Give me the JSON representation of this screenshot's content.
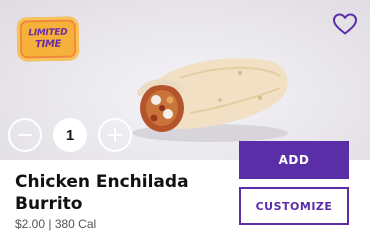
{
  "badge": {
    "line1": "LIMITED",
    "line2": "TIME"
  },
  "product": {
    "name": "Chicken Enchilada Burrito",
    "price": "$2.00",
    "separator": " | ",
    "calories": "380 Cal"
  },
  "quantity": {
    "value": "1"
  },
  "actions": {
    "add_label": "ADD",
    "customize_label": "CUSTOMIZE"
  },
  "icons": {
    "favorite": "heart-outline-icon",
    "decrement": "minus-icon",
    "increment": "plus-icon"
  },
  "colors": {
    "brand": "#5a2ea6",
    "badge": "#f6b13a"
  }
}
